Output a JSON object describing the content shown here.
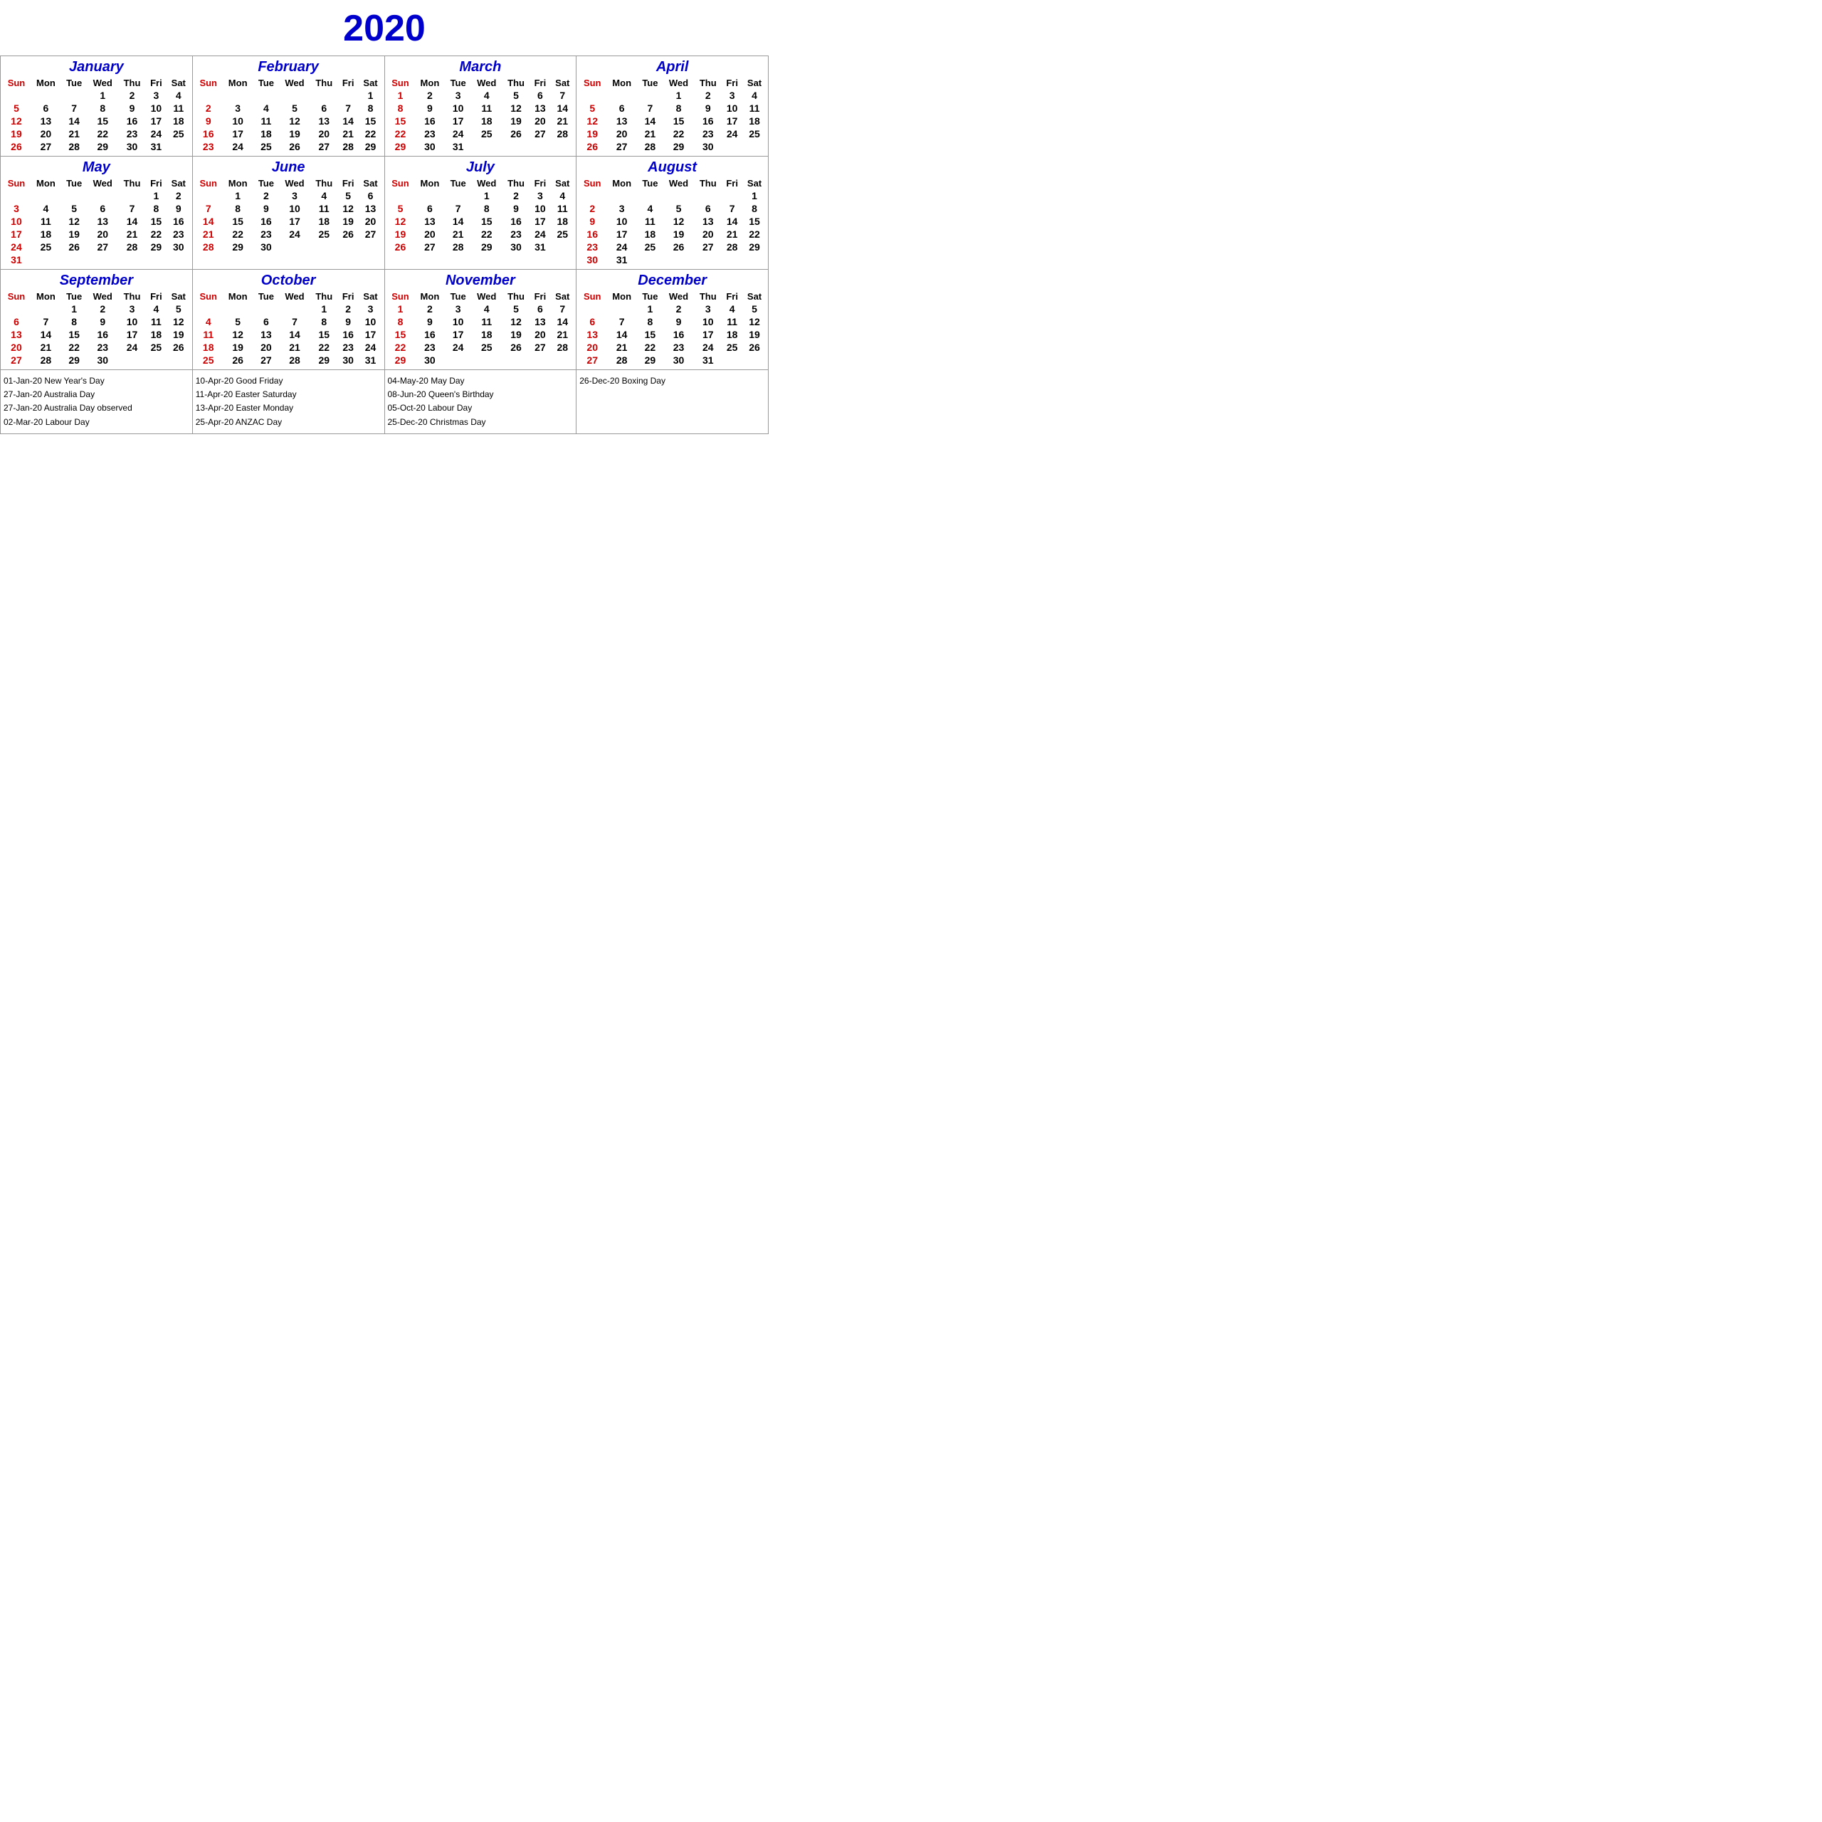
{
  "title": "2020",
  "months": [
    {
      "name": "January",
      "days_header": [
        "Sun",
        "Mon",
        "Tue",
        "Wed",
        "Thu",
        "Fri",
        "Sat"
      ],
      "weeks": [
        [
          "",
          "",
          "",
          "1",
          "2",
          "3",
          "4"
        ],
        [
          "5",
          "6",
          "7",
          "8",
          "9",
          "10",
          "11"
        ],
        [
          "12",
          "13",
          "14",
          "15",
          "16",
          "17",
          "18"
        ],
        [
          "19",
          "20",
          "21",
          "22",
          "23",
          "24",
          "25"
        ],
        [
          "26",
          "27",
          "28",
          "29",
          "30",
          "31",
          ""
        ]
      ],
      "sun_dates": [
        "5",
        "12",
        "19",
        "26"
      ]
    },
    {
      "name": "February",
      "days_header": [
        "Sun",
        "Mon",
        "Tue",
        "Wed",
        "Thu",
        "Fri",
        "Sat"
      ],
      "weeks": [
        [
          "",
          "",
          "",
          "",
          "",
          "",
          "1"
        ],
        [
          "2",
          "3",
          "4",
          "5",
          "6",
          "7",
          "8"
        ],
        [
          "9",
          "10",
          "11",
          "12",
          "13",
          "14",
          "15"
        ],
        [
          "16",
          "17",
          "18",
          "19",
          "20",
          "21",
          "22"
        ],
        [
          "23",
          "24",
          "25",
          "26",
          "27",
          "28",
          "29"
        ]
      ],
      "sun_dates": [
        "2",
        "9",
        "16",
        "23"
      ]
    },
    {
      "name": "March",
      "days_header": [
        "Sun",
        "Mon",
        "Tue",
        "Wed",
        "Thu",
        "Fri",
        "Sat"
      ],
      "weeks": [
        [
          "1",
          "2",
          "3",
          "4",
          "5",
          "6",
          "7"
        ],
        [
          "8",
          "9",
          "10",
          "11",
          "12",
          "13",
          "14"
        ],
        [
          "15",
          "16",
          "17",
          "18",
          "19",
          "20",
          "21"
        ],
        [
          "22",
          "23",
          "24",
          "25",
          "26",
          "27",
          "28"
        ],
        [
          "29",
          "30",
          "31",
          "",
          "",
          "",
          ""
        ]
      ],
      "sun_dates": [
        "1",
        "8",
        "15",
        "22",
        "29"
      ]
    },
    {
      "name": "April",
      "days_header": [
        "Sun",
        "Mon",
        "Tue",
        "Wed",
        "Thu",
        "Fri",
        "Sat"
      ],
      "weeks": [
        [
          "",
          "",
          "",
          "1",
          "2",
          "3",
          "4"
        ],
        [
          "5",
          "6",
          "7",
          "8",
          "9",
          "10",
          "11"
        ],
        [
          "12",
          "13",
          "14",
          "15",
          "16",
          "17",
          "18"
        ],
        [
          "19",
          "20",
          "21",
          "22",
          "23",
          "24",
          "25"
        ],
        [
          "26",
          "27",
          "28",
          "29",
          "30",
          "",
          ""
        ]
      ],
      "sun_dates": [
        "5",
        "12",
        "19",
        "26"
      ]
    },
    {
      "name": "May",
      "days_header": [
        "Sun",
        "Mon",
        "Tue",
        "Wed",
        "Thu",
        "Fri",
        "Sat"
      ],
      "weeks": [
        [
          "",
          "",
          "",
          "",
          "",
          "1",
          "2"
        ],
        [
          "3",
          "4",
          "5",
          "6",
          "7",
          "8",
          "9"
        ],
        [
          "10",
          "11",
          "12",
          "13",
          "14",
          "15",
          "16"
        ],
        [
          "17",
          "18",
          "19",
          "20",
          "21",
          "22",
          "23"
        ],
        [
          "24",
          "25",
          "26",
          "27",
          "28",
          "29",
          "30"
        ],
        [
          "31",
          "",
          "",
          "",
          "",
          "",
          ""
        ]
      ],
      "sun_dates": [
        "3",
        "10",
        "17",
        "24",
        "31"
      ]
    },
    {
      "name": "June",
      "days_header": [
        "Sun",
        "Mon",
        "Tue",
        "Wed",
        "Thu",
        "Fri",
        "Sat"
      ],
      "weeks": [
        [
          "",
          "1",
          "2",
          "3",
          "4",
          "5",
          "6"
        ],
        [
          "7",
          "8",
          "9",
          "10",
          "11",
          "12",
          "13"
        ],
        [
          "14",
          "15",
          "16",
          "17",
          "18",
          "19",
          "20"
        ],
        [
          "21",
          "22",
          "23",
          "24",
          "25",
          "26",
          "27"
        ],
        [
          "28",
          "29",
          "30",
          "",
          "",
          "",
          ""
        ]
      ],
      "sun_dates": [
        "7",
        "14",
        "21",
        "28"
      ]
    },
    {
      "name": "July",
      "days_header": [
        "Sun",
        "Mon",
        "Tue",
        "Wed",
        "Thu",
        "Fri",
        "Sat"
      ],
      "weeks": [
        [
          "",
          "",
          "",
          "1",
          "2",
          "3",
          "4"
        ],
        [
          "5",
          "6",
          "7",
          "8",
          "9",
          "10",
          "11"
        ],
        [
          "12",
          "13",
          "14",
          "15",
          "16",
          "17",
          "18"
        ],
        [
          "19",
          "20",
          "21",
          "22",
          "23",
          "24",
          "25"
        ],
        [
          "26",
          "27",
          "28",
          "29",
          "30",
          "31",
          ""
        ]
      ],
      "sun_dates": [
        "5",
        "12",
        "19",
        "26"
      ]
    },
    {
      "name": "August",
      "days_header": [
        "Sun",
        "Mon",
        "Tue",
        "Wed",
        "Thu",
        "Fri",
        "Sat"
      ],
      "weeks": [
        [
          "",
          "",
          "",
          "",
          "",
          "",
          "1"
        ],
        [
          "2",
          "3",
          "4",
          "5",
          "6",
          "7",
          "8"
        ],
        [
          "9",
          "10",
          "11",
          "12",
          "13",
          "14",
          "15"
        ],
        [
          "16",
          "17",
          "18",
          "19",
          "20",
          "21",
          "22"
        ],
        [
          "23",
          "24",
          "25",
          "26",
          "27",
          "28",
          "29"
        ],
        [
          "30",
          "31",
          "",
          "",
          "",
          "",
          ""
        ]
      ],
      "sun_dates": [
        "2",
        "9",
        "16",
        "23",
        "30"
      ]
    },
    {
      "name": "September",
      "days_header": [
        "Sun",
        "Mon",
        "Tue",
        "Wed",
        "Thu",
        "Fri",
        "Sat"
      ],
      "weeks": [
        [
          "",
          "",
          "1",
          "2",
          "3",
          "4",
          "5"
        ],
        [
          "6",
          "7",
          "8",
          "9",
          "10",
          "11",
          "12"
        ],
        [
          "13",
          "14",
          "15",
          "16",
          "17",
          "18",
          "19"
        ],
        [
          "20",
          "21",
          "22",
          "23",
          "24",
          "25",
          "26"
        ],
        [
          "27",
          "28",
          "29",
          "30",
          "",
          "",
          ""
        ]
      ],
      "sun_dates": [
        "6",
        "13",
        "20",
        "27"
      ]
    },
    {
      "name": "October",
      "days_header": [
        "Sun",
        "Mon",
        "Tue",
        "Wed",
        "Thu",
        "Fri",
        "Sat"
      ],
      "weeks": [
        [
          "",
          "",
          "",
          "",
          "1",
          "2",
          "3"
        ],
        [
          "4",
          "5",
          "6",
          "7",
          "8",
          "9",
          "10"
        ],
        [
          "11",
          "12",
          "13",
          "14",
          "15",
          "16",
          "17"
        ],
        [
          "18",
          "19",
          "20",
          "21",
          "22",
          "23",
          "24"
        ],
        [
          "25",
          "26",
          "27",
          "28",
          "29",
          "30",
          "31"
        ]
      ],
      "sun_dates": [
        "4",
        "11",
        "18",
        "25"
      ]
    },
    {
      "name": "November",
      "days_header": [
        "Sun",
        "Mon",
        "Tue",
        "Wed",
        "Thu",
        "Fri",
        "Sat"
      ],
      "weeks": [
        [
          "1",
          "2",
          "3",
          "4",
          "5",
          "6",
          "7"
        ],
        [
          "8",
          "9",
          "10",
          "11",
          "12",
          "13",
          "14"
        ],
        [
          "15",
          "16",
          "17",
          "18",
          "19",
          "20",
          "21"
        ],
        [
          "22",
          "23",
          "24",
          "25",
          "26",
          "27",
          "28"
        ],
        [
          "29",
          "30",
          "",
          "",
          "",
          "",
          ""
        ]
      ],
      "sun_dates": [
        "1",
        "8",
        "15",
        "22",
        "29"
      ]
    },
    {
      "name": "December",
      "days_header": [
        "Sun",
        "Mon",
        "Tue",
        "Wed",
        "Thu",
        "Fri",
        "Sat"
      ],
      "weeks": [
        [
          "",
          "",
          "1",
          "2",
          "3",
          "4",
          "5"
        ],
        [
          "6",
          "7",
          "8",
          "9",
          "10",
          "11",
          "12"
        ],
        [
          "13",
          "14",
          "15",
          "16",
          "17",
          "18",
          "19"
        ],
        [
          "20",
          "21",
          "22",
          "23",
          "24",
          "25",
          "26"
        ],
        [
          "27",
          "28",
          "29",
          "30",
          "31",
          "",
          ""
        ]
      ],
      "sun_dates": [
        "6",
        "13",
        "20",
        "27"
      ]
    }
  ],
  "notes": [
    {
      "lines": [
        "01-Jan-20 New Year's Day",
        "27-Jan-20 Australia Day",
        "27-Jan-20 Australia Day observed",
        "02-Mar-20 Labour Day"
      ]
    },
    {
      "lines": [
        "10-Apr-20 Good Friday",
        "11-Apr-20 Easter Saturday",
        "13-Apr-20 Easter Monday",
        "25-Apr-20 ANZAC Day"
      ]
    },
    {
      "lines": [
        "04-May-20 May Day",
        "08-Jun-20 Queen's Birthday",
        "05-Oct-20 Labour Day",
        "25-Dec-20 Christmas Day"
      ]
    },
    {
      "lines": [
        "26-Dec-20 Boxing Day"
      ]
    }
  ]
}
